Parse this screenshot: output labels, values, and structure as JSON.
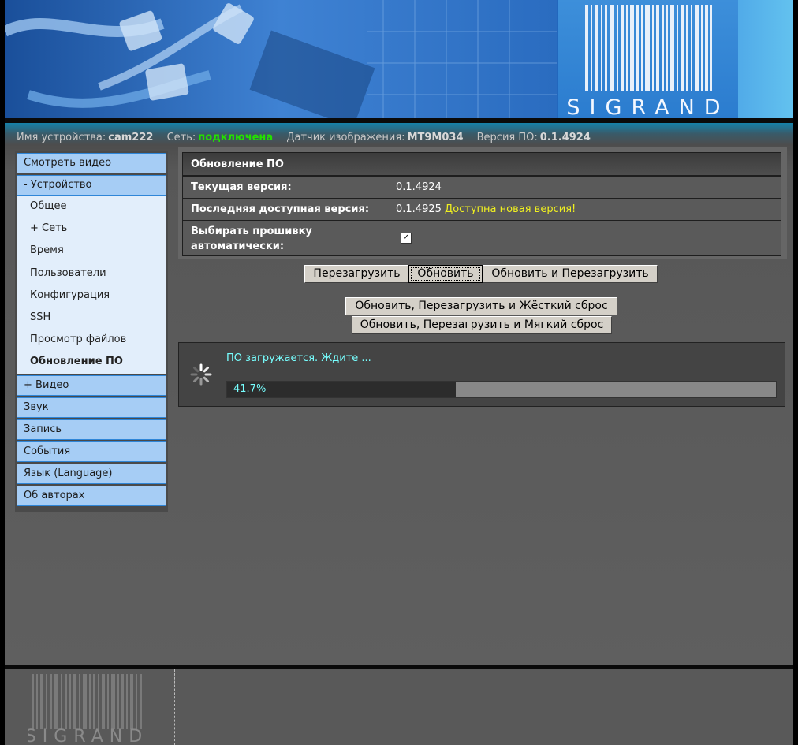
{
  "header": {
    "brand": "SIGRAND"
  },
  "status": {
    "device_label": "Имя устройства:",
    "device_value": "cam222",
    "network_label": "Сеть:",
    "network_value": "подключена",
    "sensor_label": "Датчик изображения:",
    "sensor_value": "MT9M034",
    "version_label": "Версия ПО:",
    "version_value": "0.1.4924"
  },
  "sidebar": {
    "items": [
      {
        "label": "Смотреть видео"
      },
      {
        "label": "- Устройство"
      }
    ],
    "subitems": [
      {
        "label": "Общее"
      },
      {
        "label": "+ Сеть"
      },
      {
        "label": "Время"
      },
      {
        "label": "Пользователи"
      },
      {
        "label": "Конфигурация"
      },
      {
        "label": "SSH"
      },
      {
        "label": "Просмотр файлов"
      },
      {
        "label": "Обновление ПО"
      }
    ],
    "bottom": [
      {
        "label": "+ Видео"
      },
      {
        "label": "Звук"
      },
      {
        "label": "Запись"
      },
      {
        "label": "События"
      },
      {
        "label": "Язык (Language)"
      },
      {
        "label": "Об авторах"
      }
    ]
  },
  "firmware": {
    "title": "Обновление ПО",
    "current_label": "Текущая версия:",
    "current_value": "0.1.4924",
    "latest_label": "Последняя доступная версия:",
    "latest_value": "0.1.4925",
    "latest_note": "Доступна новая версия!",
    "auto_label": "Выбирать прошивку автоматически:",
    "auto_checked": true
  },
  "buttons": {
    "reboot": "Перезагрузить",
    "update": "Обновить",
    "update_reboot": "Обновить и Перезагрузить",
    "update_hard_reset": "Обновить, Перезагрузить и Жёсткий сброс",
    "update_soft_reset": "Обновить, Перезагрузить и Мягкий сброс"
  },
  "progress": {
    "message": "ПО загружается. Ждите ...",
    "percent_text": "41.7%",
    "value": 0.417
  },
  "footer": {
    "brand": "SIGRAND"
  },
  "colors": {
    "network_ok": "#22e000",
    "new_version": "#f0f020",
    "progress_text": "#77ffff",
    "nav_bg": "#a6cdf5"
  }
}
